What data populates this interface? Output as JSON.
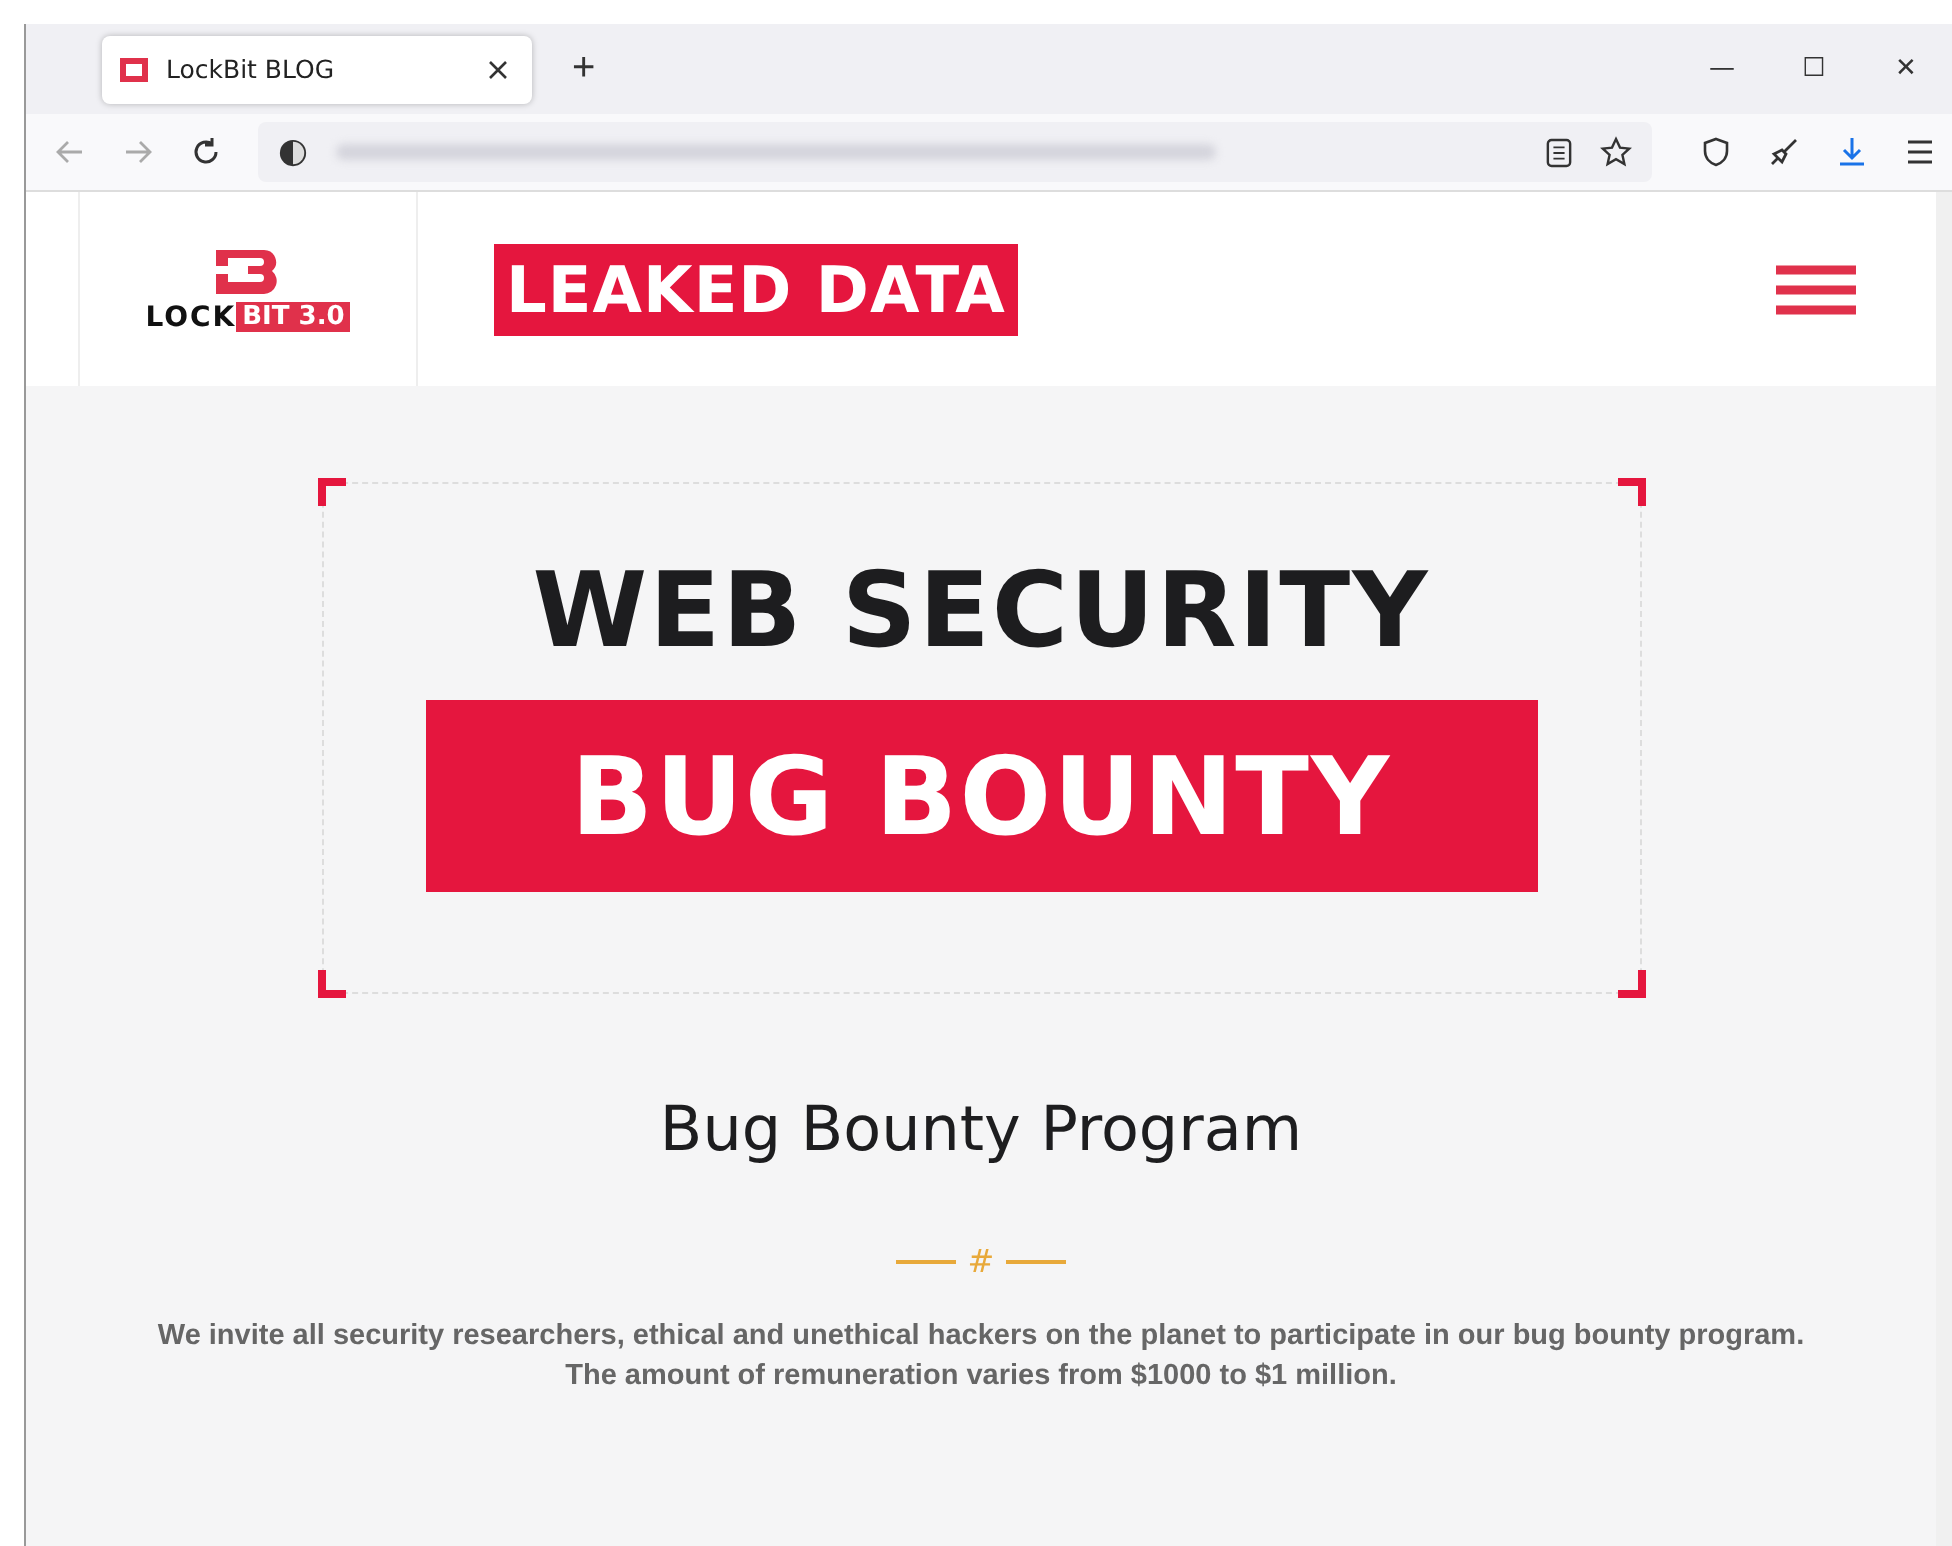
{
  "browser": {
    "tabs": [
      {
        "title": "LockBit BLOG",
        "selected": true
      }
    ],
    "new_tab": "+",
    "window_buttons": [
      "—",
      "☐",
      "✕"
    ]
  },
  "header": {
    "logo_word": "LOCK",
    "logo_badge": "BIT 3.0",
    "nav_banner": "LEAKED DATA"
  },
  "hero": {
    "title": "WEB SECURITY",
    "banner": "BUG BOUNTY"
  },
  "section": {
    "heading": "Bug Bounty Program",
    "divider_mark": "#",
    "lines": [
      "We invite all security researchers, ethical and unethical hackers on the planet to participate in our bug bounty program.",
      "The amount of remuneration varies from $1000 to $1 million."
    ]
  }
}
